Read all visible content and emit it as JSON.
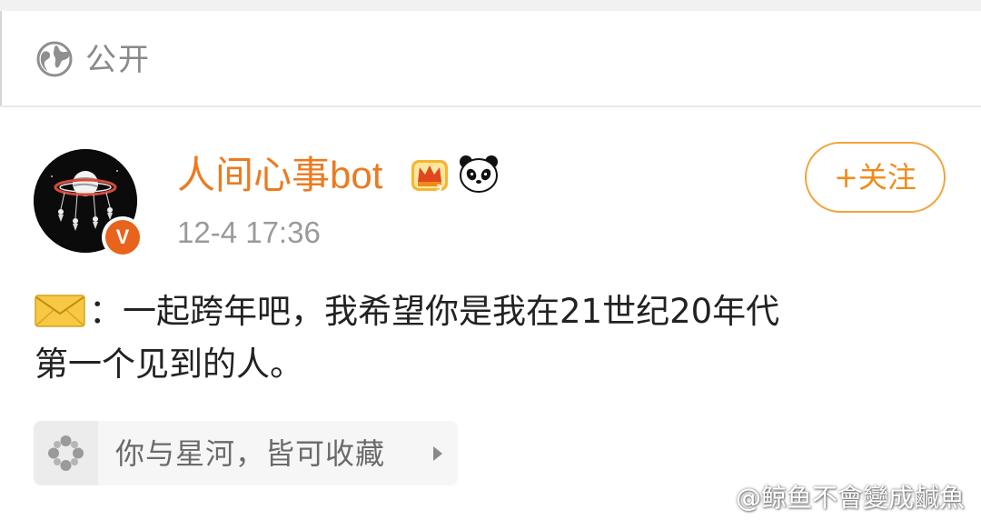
{
  "visibility": {
    "icon": "globe-icon",
    "label": "公开"
  },
  "post": {
    "author": {
      "name": "人间心事bot",
      "avatar": "planet-avatar",
      "verified_badge_label": "V",
      "badges": [
        "crown-icon",
        "panda-icon"
      ]
    },
    "timestamp": "12-4 17:36",
    "follow_label": "+关注",
    "text_line1": "：一起跨年吧，我希望你是我在21世纪20年代",
    "text_line2": "第一个见到的人。",
    "emoji": "envelope-icon",
    "topic": {
      "icon": "pinwheel-icon",
      "label": "你与星河，皆可收藏"
    }
  },
  "watermark": {
    "text": "@鲸鱼不會變成鹹魚",
    "logo": "weibo-logo-icon"
  },
  "colors": {
    "username": "#eb7b22",
    "follow_border": "#f0a43a",
    "verified_badge": "#e8631c",
    "secondary_text": "#9a9a9a"
  }
}
